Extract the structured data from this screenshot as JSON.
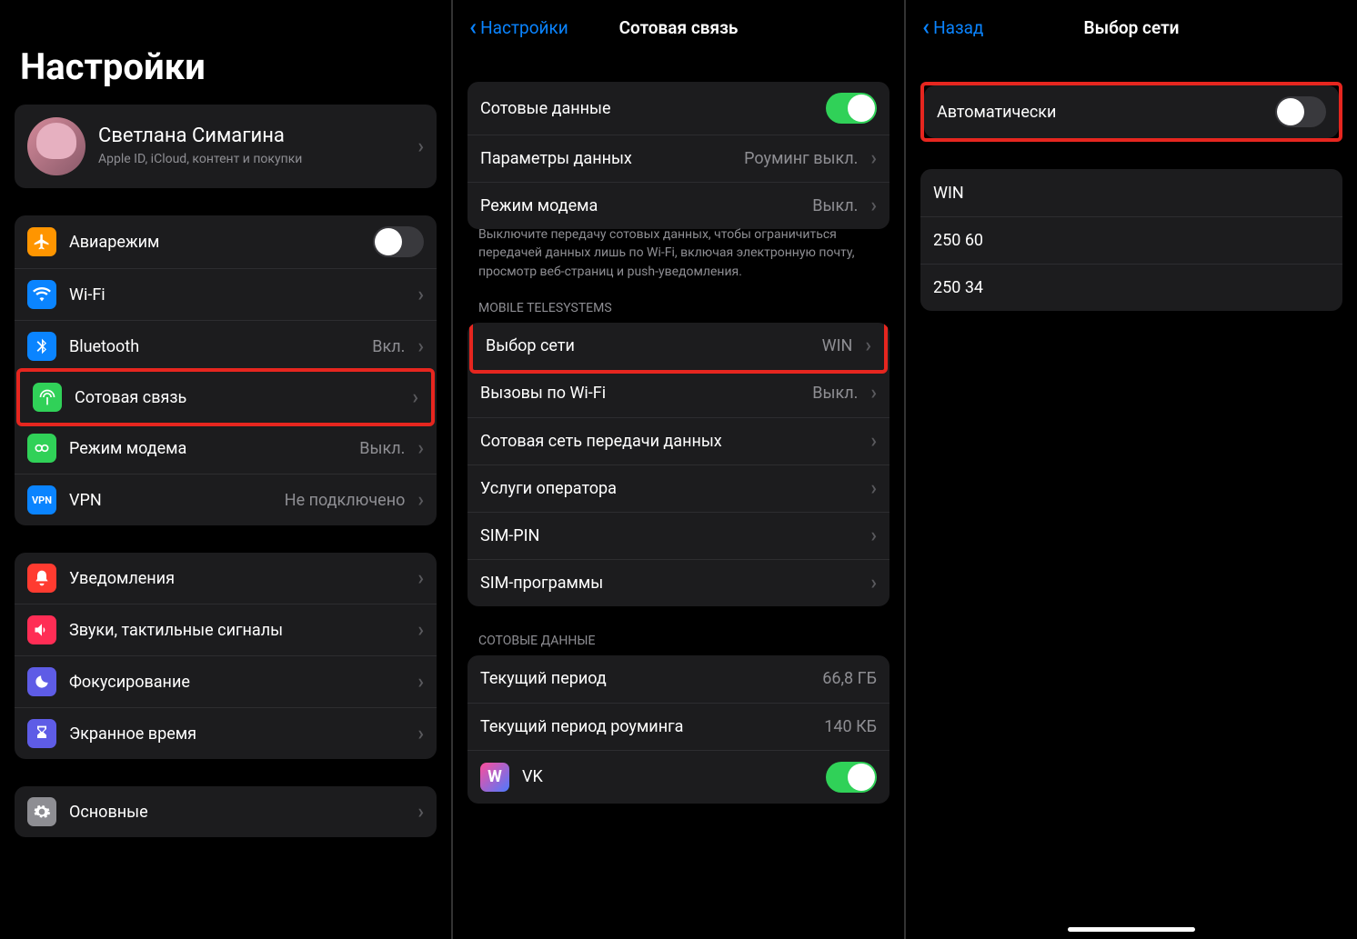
{
  "p1": {
    "title": "Настройки",
    "profile": {
      "name": "Светлана Симагина",
      "sub": "Apple ID, iCloud, контент и покупки"
    },
    "rows": {
      "airplane": "Авиарежим",
      "wifi": "Wi-Fi",
      "bluetooth": "Bluetooth",
      "bluetooth_val": "Вкл.",
      "cellular": "Сотовая связь",
      "hotspot": "Режим модема",
      "hotspot_val": "Выкл.",
      "vpn": "VPN",
      "vpn_val": "Не подключено",
      "notif": "Уведомления",
      "sound": "Звуки, тактильные сигналы",
      "focus": "Фокусирование",
      "screentime": "Экранное время",
      "general": "Основные"
    }
  },
  "p2": {
    "back": "Настройки",
    "title": "Сотовая связь",
    "rows": {
      "data": "Сотовые данные",
      "options": "Параметры данных",
      "options_val": "Роуминг выкл.",
      "hotspot": "Режим модема",
      "hotspot_val": "Выкл."
    },
    "footnote": "Выключите передачу сотовых данных, чтобы ограничиться передачей данных лишь по Wi-Fi, включая электронную почту, просмотр веб-страниц и push-уведомления.",
    "hdr_operator": "MOBILE TELESYSTEMS",
    "op_rows": {
      "netsel": "Выбор сети",
      "netsel_val": "WIN",
      "wificall": "Вызовы по Wi-Fi",
      "wificall_val": "Выкл.",
      "datanet": "Сотовая сеть передачи данных",
      "services": "Услуги оператора",
      "simpin": "SIM-PIN",
      "simapps": "SIM-программы"
    },
    "hdr_data": "СОТОВЫЕ ДАННЫЕ",
    "usage": {
      "period": "Текущий период",
      "period_val": "66,8 ГБ",
      "roaming": "Текущий период роуминга",
      "roaming_val": "140 КБ",
      "vk": "VK"
    }
  },
  "p3": {
    "back": "Назад",
    "title": "Выбор сети",
    "auto": "Автоматически",
    "networks": [
      "WIN",
      "250 60",
      "250 34"
    ]
  }
}
